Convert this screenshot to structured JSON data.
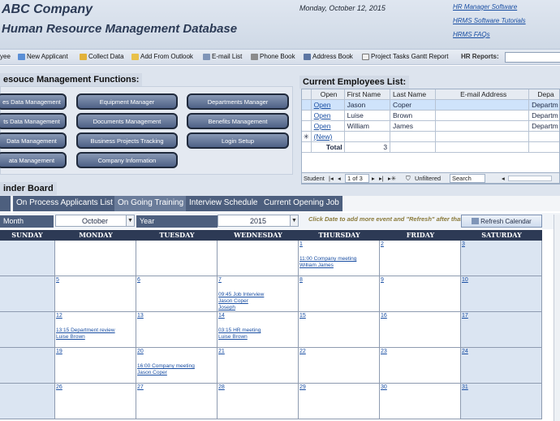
{
  "header": {
    "company": "ABC Company",
    "title": "Human Resource Management Database",
    "date": "Monday, October 12, 2015",
    "links": [
      "HR Manager Software",
      "HRMS Software Tutorials",
      "HRMS FAQs"
    ]
  },
  "toolbar": {
    "items": [
      {
        "label": "yee",
        "icon": "person-icon"
      },
      {
        "label": "New Applicant",
        "icon": "new-applicant-icon"
      },
      {
        "label": "Collect Data",
        "icon": "collect-data-icon"
      },
      {
        "label": "Add From Outlook",
        "icon": "outlook-icon"
      },
      {
        "label": "E-mail List",
        "icon": "email-icon"
      },
      {
        "label": "Phone Book",
        "icon": "phone-icon"
      },
      {
        "label": "Address Book",
        "icon": "address-book-icon"
      },
      {
        "label": "Project Tasks Gantt Report",
        "icon": "gantt-icon"
      }
    ],
    "hr_reports_label": "HR Reports:"
  },
  "functions": {
    "title": "esouce Management Functions:",
    "buttons": [
      "es Data Management",
      "Equipment Manager",
      "Departments Manager",
      "ts Data Management",
      "Documents Management",
      "Benefits Management",
      "Data Management",
      "Business Projects Tracking",
      "Login Setup",
      "ata Management",
      "Company Information"
    ]
  },
  "employees": {
    "title": "Current Employees List:",
    "columns": [
      "Open",
      "First Name",
      "Last Name",
      "E-mail Address",
      "Depa"
    ],
    "rows": [
      {
        "open": "Open",
        "first": "Jason",
        "last": "Coper",
        "email": "",
        "dept": "Departm"
      },
      {
        "open": "Open",
        "first": "Luise",
        "last": "Brown",
        "email": "",
        "dept": "Departm"
      },
      {
        "open": "Open",
        "first": "William",
        "last": "James",
        "email": "",
        "dept": "Departm"
      }
    ],
    "new_label": "(New)",
    "total_label": "Total",
    "total_value": "3",
    "nav": {
      "record_label": "Student",
      "position": "1 of 3",
      "filter": "Unfiltered",
      "search": "Search"
    }
  },
  "board": {
    "title": "inder Board",
    "tabs": [
      "",
      "On Process Applicants List",
      "On Going Training",
      "Interview Schedule",
      "Current Opening Job"
    ],
    "month_label": "Month",
    "month_value": "October",
    "year_label": "Year",
    "year_value": "2015",
    "hint": "Click Date to add more event and \"Refresh\" after that.",
    "refresh_label": "Refresh Calendar"
  },
  "calendar": {
    "days": [
      "SUNDAY",
      "MONDAY",
      "TUESDAY",
      "WEDNESDAY",
      "THURSDAY",
      "FRIDAY",
      "SATURDAY"
    ],
    "weeks": [
      [
        {
          "d": ""
        },
        {
          "d": ""
        },
        {
          "d": ""
        },
        {
          "d": ""
        },
        {
          "d": "1",
          "ev": [
            "11:00 Company meeting",
            "William James"
          ]
        },
        {
          "d": "2"
        },
        {
          "d": "3"
        }
      ],
      [
        {
          "d": ""
        },
        {
          "d": "5"
        },
        {
          "d": "6"
        },
        {
          "d": "7",
          "ev": [
            "09:45 Job Interview",
            "Jason Coper",
            "Joseph"
          ]
        },
        {
          "d": "8"
        },
        {
          "d": "9"
        },
        {
          "d": "10"
        }
      ],
      [
        {
          "d": ""
        },
        {
          "d": "12",
          "ev": [
            "13:15 Department review",
            "Luise Brown"
          ]
        },
        {
          "d": "13"
        },
        {
          "d": "14",
          "ev": [
            "03:15 HR meeting",
            "Luise Brown"
          ]
        },
        {
          "d": "15"
        },
        {
          "d": "16"
        },
        {
          "d": "17"
        }
      ],
      [
        {
          "d": ""
        },
        {
          "d": "19"
        },
        {
          "d": "20",
          "ev": [
            "16:00 Company meeting",
            "Jason Coper"
          ]
        },
        {
          "d": "21"
        },
        {
          "d": "22"
        },
        {
          "d": "23"
        },
        {
          "d": "24"
        }
      ],
      [
        {
          "d": ""
        },
        {
          "d": "26"
        },
        {
          "d": "27"
        },
        {
          "d": "28"
        },
        {
          "d": "29"
        },
        {
          "d": "30"
        },
        {
          "d": "31"
        }
      ]
    ]
  }
}
